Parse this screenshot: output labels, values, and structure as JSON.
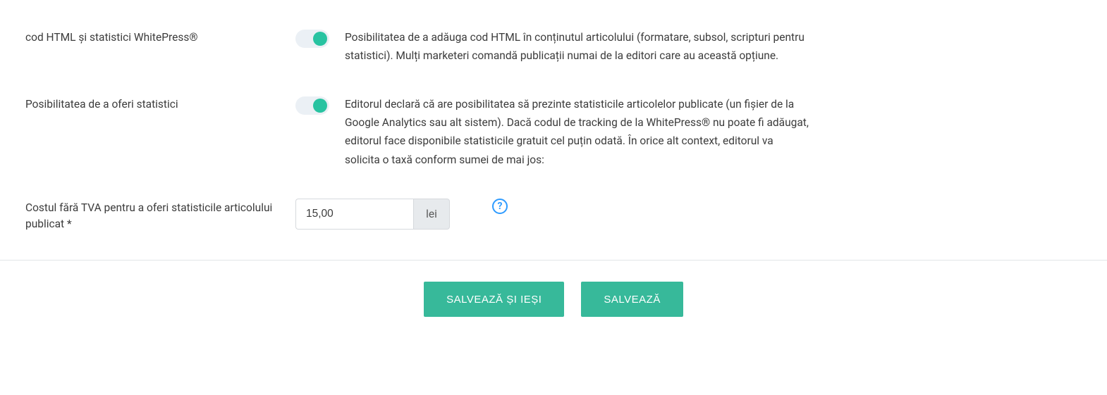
{
  "rows": {
    "html_code": {
      "label": "cod HTML și statistici WhitePress®",
      "description": "Posibilitatea de a adăuga cod HTML în conținutul articolului (formatare, subsol, scripturi pentru statistici). Mulți marketeri comandă publicații numai de la editori care au această opțiune."
    },
    "stats": {
      "label": "Posibilitatea de a oferi statistici",
      "description": "Editorul declară că are posibilitatea să prezinte statisticile articolelor publicate (un fișier de la Google Analytics sau alt sistem). Dacă codul de tracking de la WhitePress® nu poate fi adăugat, editorul face disponibile statisticile gratuit cel puțin odată. În orice alt context, editorul va solicita o taxă conform sumei de mai jos:"
    },
    "cost": {
      "label": "Costul fără TVA pentru a oferi statisticile articolului publicat *",
      "value": "15,00",
      "unit": "lei"
    }
  },
  "buttons": {
    "save_exit": "SALVEAZĂ ȘI IEȘI",
    "save": "SALVEAZĂ"
  },
  "help_glyph": "?"
}
